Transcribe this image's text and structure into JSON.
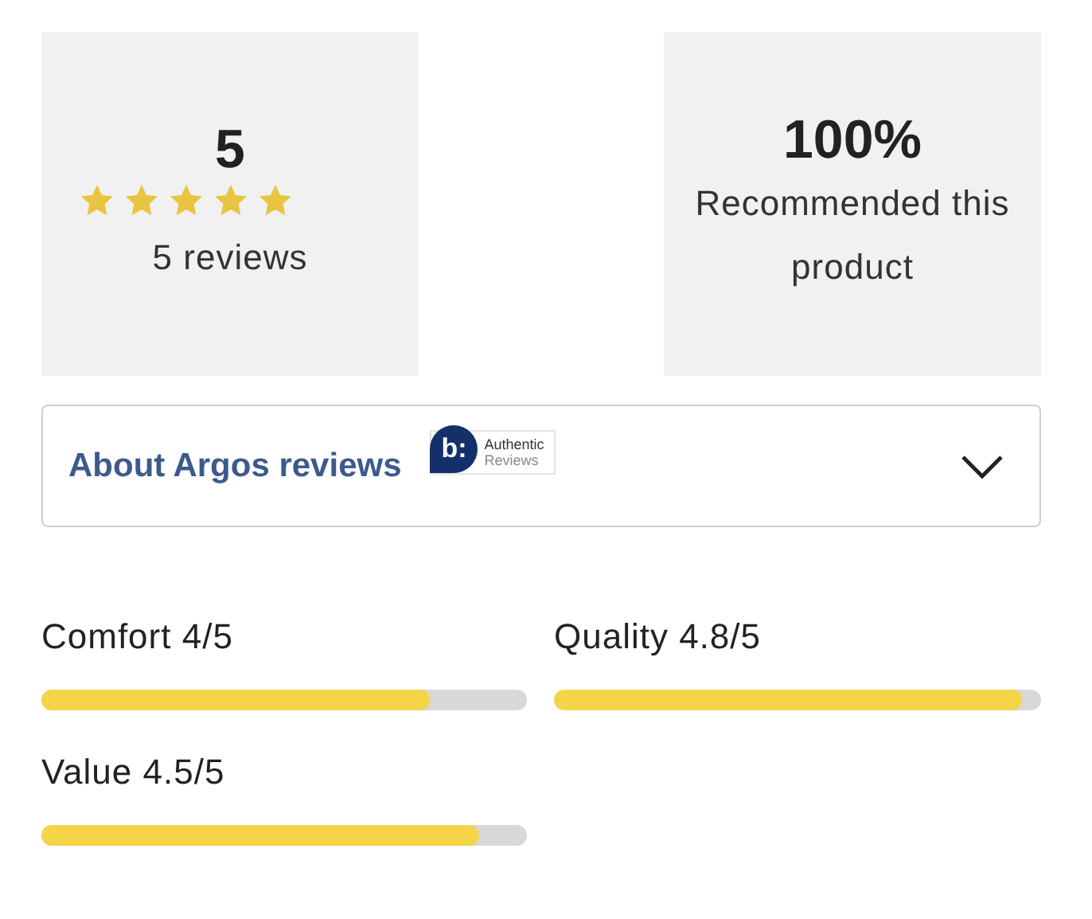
{
  "summary": {
    "rating": "5",
    "stars": 5,
    "reviews": "5 reviews"
  },
  "recommend": {
    "percent": "100%",
    "label": "Recommended this product"
  },
  "about": {
    "title": "About Argos reviews",
    "badge": {
      "mark": "b:",
      "line1": "Authentic",
      "line2": "Reviews"
    },
    "expanded": false
  },
  "ratings": [
    {
      "label": "Comfort",
      "score": "4/5",
      "level": 0.8
    },
    {
      "label": "Quality",
      "score": "4.8/5",
      "level": 0.96
    },
    {
      "label": "Value",
      "score": "4.5/5",
      "level": 0.9
    }
  ]
}
